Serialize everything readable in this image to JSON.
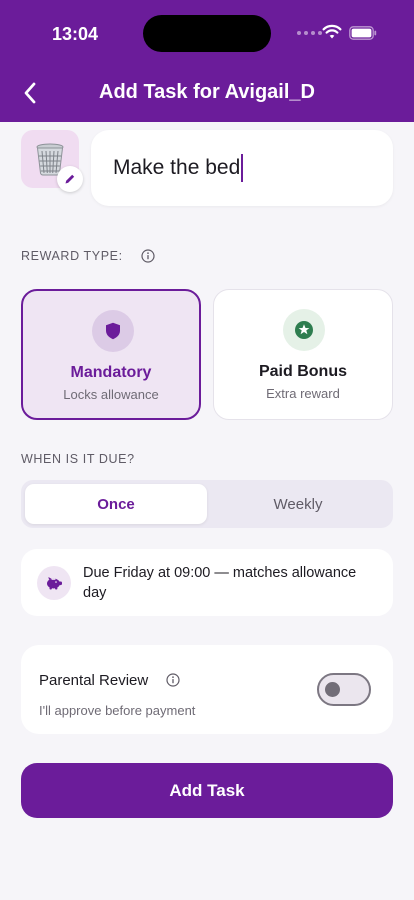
{
  "status_bar": {
    "time": "13:04"
  },
  "header": {
    "title": "Add Task for Avigail_D",
    "back_icon": "chevron-left-icon"
  },
  "task": {
    "icon": "wastebasket-icon",
    "name": "Make the bed",
    "edit_icon": "pencil-icon"
  },
  "reward_section": {
    "label": "REWARD TYPE:",
    "options": [
      {
        "title": "Mandatory",
        "subtitle": "Locks allowance",
        "icon": "shield-icon",
        "selected": true
      },
      {
        "title": "Paid Bonus",
        "subtitle": "Extra reward",
        "icon": "star-badge-icon",
        "selected": false
      }
    ]
  },
  "due_section": {
    "label": "WHEN IS IT DUE?",
    "options": [
      "Once",
      "Weekly"
    ],
    "selected": "Once",
    "summary": "Due Friday at 09:00 — matches allowance day",
    "summary_icon": "piggy-bank-icon"
  },
  "review": {
    "title": "Parental Review",
    "subtitle": "I'll approve before payment",
    "enabled": false
  },
  "submit": {
    "label": "Add Task"
  },
  "colors": {
    "primary": "#6b1c9a",
    "selected_card_bg": "#efe5f3",
    "star_green": "#2e7d4f",
    "background": "#f6f5f9"
  }
}
